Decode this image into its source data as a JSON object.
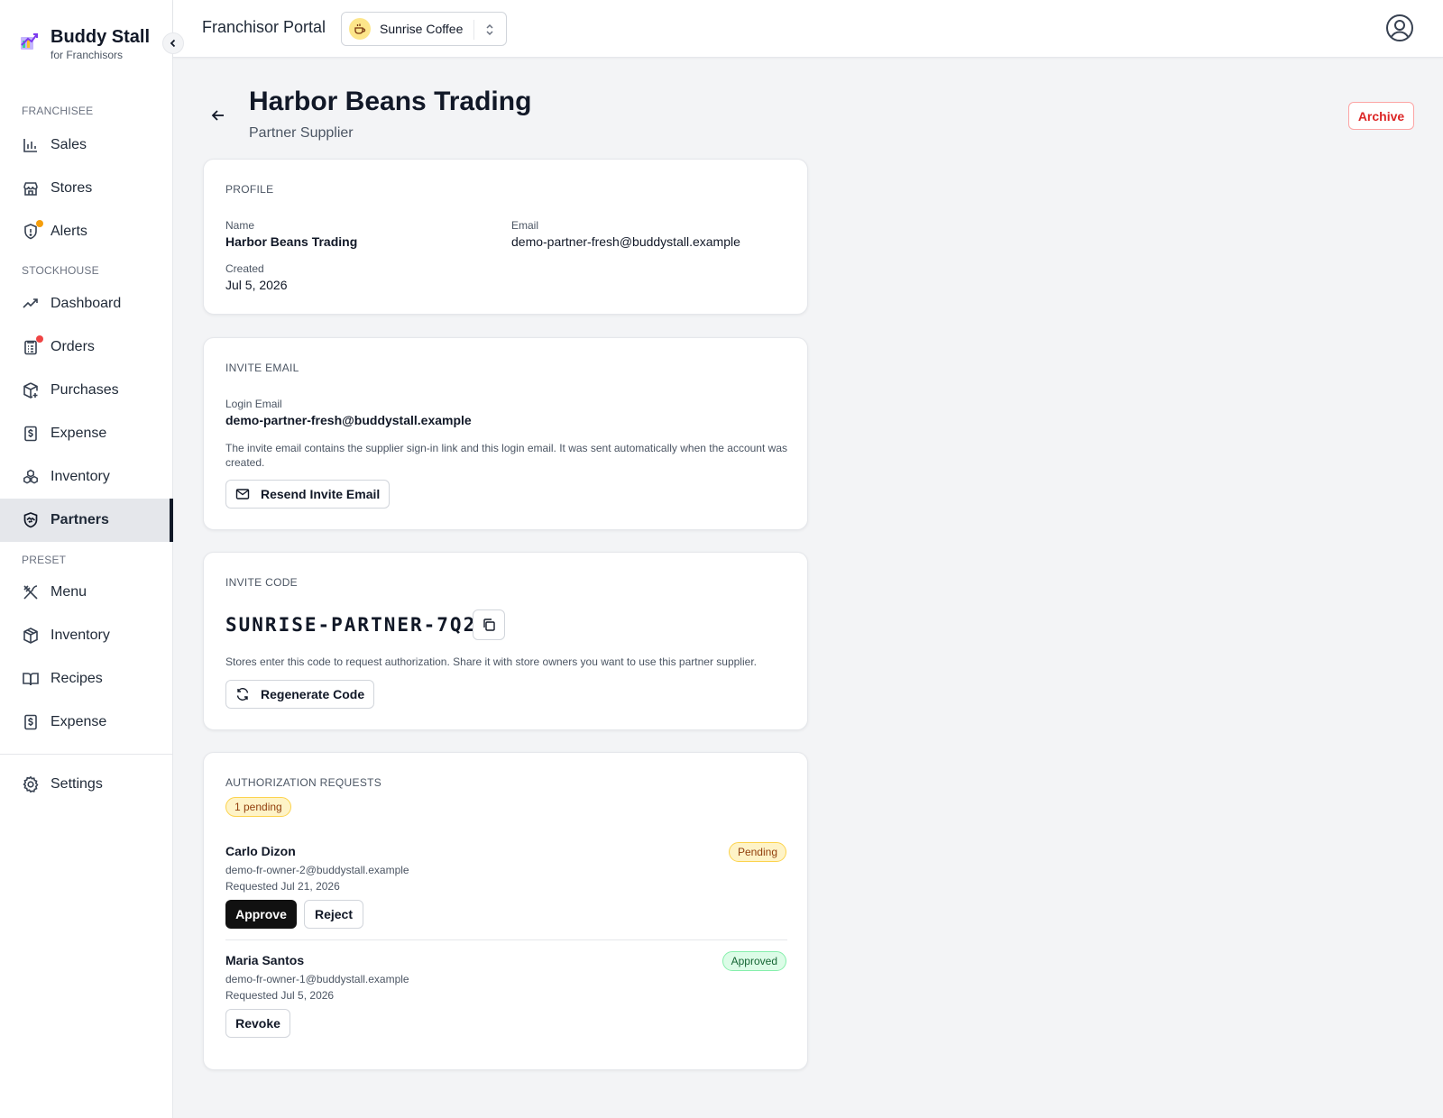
{
  "brand": {
    "name": "Buddy Stall",
    "subtitle": "for Franchisors"
  },
  "topbar": {
    "title": "Franchisor Portal",
    "selected_brand": "Sunrise Coffee"
  },
  "sidebar": {
    "sections": {
      "franchisee": "FRANCHISEE",
      "stockhouse": "STOCKHOUSE",
      "preset": "PRESET"
    },
    "items": {
      "sales": "Sales",
      "stores": "Stores",
      "alerts": "Alerts",
      "dashboard": "Dashboard",
      "orders": "Orders",
      "purchases": "Purchases",
      "expense_stock": "Expense",
      "inventory_stock": "Inventory",
      "partners": "Partners",
      "menu": "Menu",
      "inventory_preset": "Inventory",
      "recipes": "Recipes",
      "expense_preset": "Expense",
      "settings": "Settings"
    },
    "active": "Partners",
    "colors": {
      "alerts_dot": "#f59e0b",
      "orders_dot": "#ef4444"
    }
  },
  "page": {
    "title": "Harbor Beans Trading",
    "subtitle": "Partner Supplier",
    "archive_label": "Archive"
  },
  "profile": {
    "heading": "PROFILE",
    "name_label": "Name",
    "name": "Harbor Beans Trading",
    "email_label": "Email",
    "email": "demo-partner-fresh@buddystall.example",
    "created_label": "Created",
    "created": "Jul 5, 2026"
  },
  "invite_email": {
    "heading": "INVITE EMAIL",
    "login_label": "Login Email",
    "login_email": "demo-partner-fresh@buddystall.example",
    "help": "The invite email contains the supplier sign-in link and this login email. It was sent automatically when the account was created.",
    "resend_label": "Resend Invite Email"
  },
  "invite_code": {
    "heading": "INVITE CODE",
    "code": "SUNRISE-PARTNER-7Q2",
    "help": "Stores enter this code to request authorization. Share it with store owners you want to use this partner supplier.",
    "regenerate_label": "Regenerate Code"
  },
  "authorization": {
    "heading": "AUTHORIZATION REQUESTS",
    "pending_count": "1 pending",
    "requests": [
      {
        "name": "Carlo Dizon",
        "email": "demo-fr-owner-2@buddystall.example",
        "requested": "Requested Jul 21, 2026",
        "status": "Pending",
        "approve_label": "Approve",
        "reject_label": "Reject"
      },
      {
        "name": "Maria Santos",
        "email": "demo-fr-owner-1@buddystall.example",
        "requested": "Requested Jul 5, 2026",
        "status": "Approved",
        "revoke_label": "Revoke"
      }
    ]
  }
}
